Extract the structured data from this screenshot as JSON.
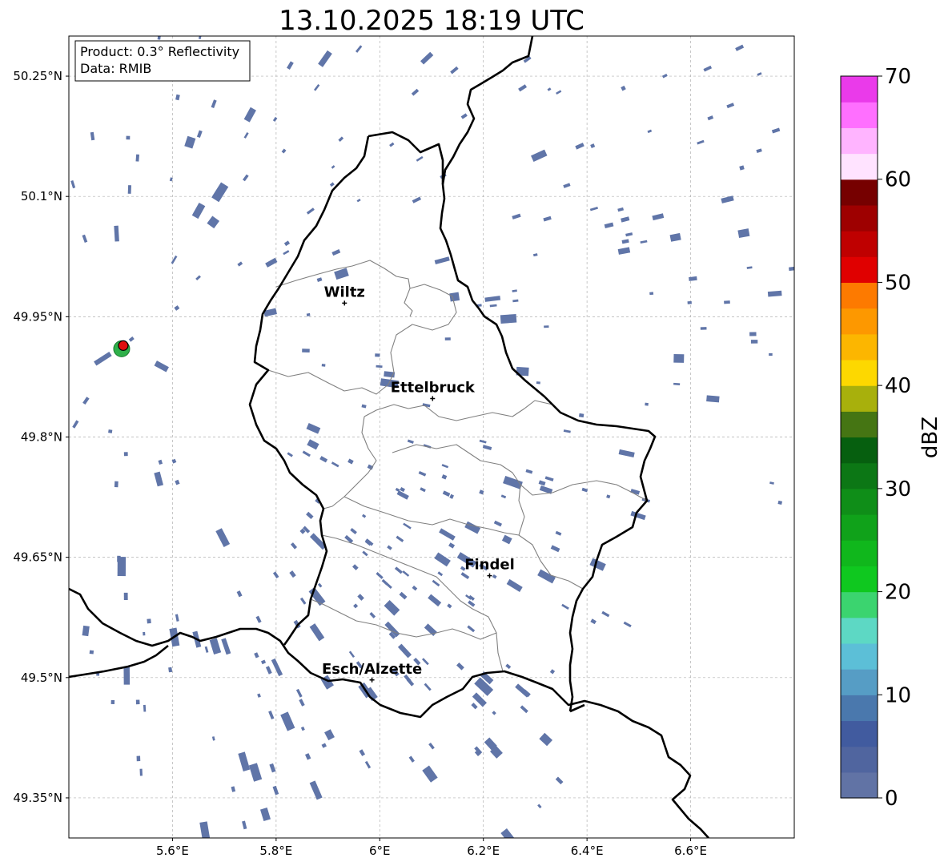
{
  "title": "13.10.2025 18:19 UTC",
  "info_box": {
    "product": "Product: 0.3° Reflectivity",
    "data": "Data: RMIB"
  },
  "map": {
    "lon_range": [
      5.4,
      6.8
    ],
    "lat_range": [
      49.3,
      50.3
    ],
    "lon_ticks": [
      {
        "value": 5.6,
        "label": "5.6°E"
      },
      {
        "value": 5.8,
        "label": "5.8°E"
      },
      {
        "value": 6.0,
        "label": "6°E"
      },
      {
        "value": 6.2,
        "label": "6.2°E"
      },
      {
        "value": 6.4,
        "label": "6.4°E"
      },
      {
        "value": 6.6,
        "label": "6.6°E"
      }
    ],
    "lat_ticks": [
      {
        "value": 50.25,
        "label": "50.25°N"
      },
      {
        "value": 50.1,
        "label": "50.1°N"
      },
      {
        "value": 49.95,
        "label": "49.95°N"
      },
      {
        "value": 49.8,
        "label": "49.8°N"
      },
      {
        "value": 49.65,
        "label": "49.65°N"
      },
      {
        "value": 49.5,
        "label": "49.5°N"
      },
      {
        "value": 49.35,
        "label": "49.35°N"
      }
    ],
    "cities": [
      {
        "name": "Wiltz",
        "lon": 5.932,
        "lat": 49.967
      },
      {
        "name": "Ettelbruck",
        "lon": 6.102,
        "lat": 49.848
      },
      {
        "name": "Findel",
        "lon": 6.212,
        "lat": 49.627
      },
      {
        "name": "Esch/Alzette",
        "lon": 5.985,
        "lat": 49.497
      }
    ],
    "radar_site": {
      "lon": 5.505,
      "lat": 49.914
    },
    "colors": {
      "border": "#000000",
      "canton": "#808080",
      "grid": "#b0b0b0",
      "echo": "#6075a8",
      "radar_outer": "#2fb04a",
      "radar_inner": "#e01010"
    }
  },
  "colorbar": {
    "label": "dBZ",
    "min": 0,
    "max": 70,
    "step": 2.5,
    "ticks": [
      0,
      10,
      20,
      30,
      40,
      50,
      60,
      70
    ],
    "colors": [
      "#6173a5",
      "#50659f",
      "#415b9f",
      "#4a78ad",
      "#569dc5",
      "#5cbfd7",
      "#5dd8c4",
      "#3bd46f",
      "#0fc81f",
      "#10b71c",
      "#10a21a",
      "#0f8e18",
      "#0c7715",
      "#065f0f",
      "#457513",
      "#a8b00c",
      "#fdd800",
      "#fcb600",
      "#fd9800",
      "#fd7a00",
      "#e00000",
      "#bf0000",
      "#9e0000",
      "#760000",
      "#ffe3ff",
      "#ffb4ff",
      "#ff6fff",
      "#ea3aea"
    ]
  }
}
